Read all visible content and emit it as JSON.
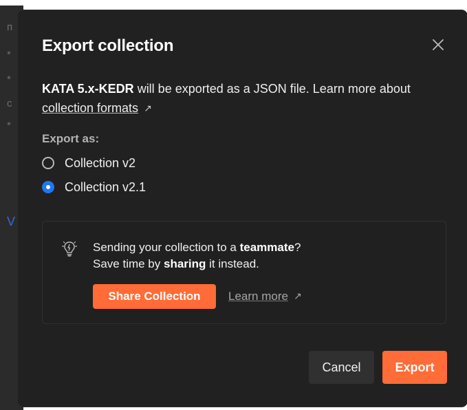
{
  "background": {
    "glyphs": [
      "п",
      "*",
      "*",
      "c",
      "*",
      "V"
    ]
  },
  "modal": {
    "title": "Export collection",
    "close_icon": "close-icon",
    "description": {
      "collection_name": "KATA 5.x-KEDR",
      "text_after_name": " will be exported as a JSON file. Learn more about",
      "link_text": "collection formats",
      "external_icon": "external-link-icon"
    },
    "export_as": {
      "label": "Export as:",
      "options": [
        {
          "label": "Collection v2",
          "selected": false
        },
        {
          "label": "Collection v2.1",
          "selected": true
        }
      ]
    },
    "share_box": {
      "icon": "lightbulb-icon",
      "line1_prefix": "Sending your collection to a ",
      "line1_emphasis": "teammate",
      "line1_suffix": "?",
      "line2_prefix": "Save time by ",
      "line2_emphasis": "sharing",
      "line2_suffix": " it instead.",
      "share_button": "Share Collection",
      "learn_more": "Learn more",
      "learn_more_icon": "external-link-icon"
    },
    "actions": {
      "cancel": "Cancel",
      "export": "Export"
    }
  },
  "colors": {
    "modal_background": "#212121",
    "accent_orange": "#ff6c37",
    "radio_blue": "#1f77f2",
    "muted_text": "#b3b3b3"
  }
}
